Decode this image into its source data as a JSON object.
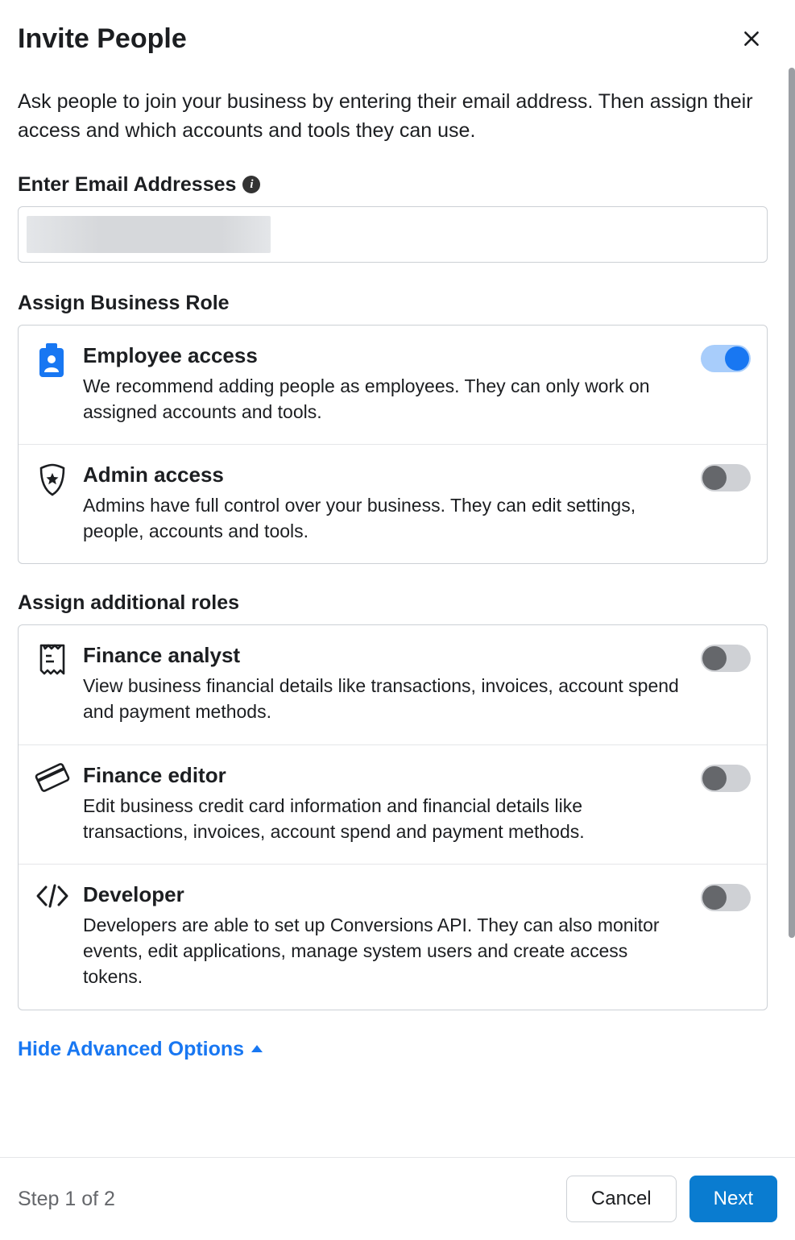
{
  "title": "Invite People",
  "description": "Ask people to join your business by entering their email address. Then assign their access and which accounts and tools they can use.",
  "email_section_label": "Enter Email Addresses",
  "business_role_label": "Assign Business Role",
  "business_roles": [
    {
      "title": "Employee access",
      "description": "We recommend adding people as employees. They can only work on assigned accounts and tools.",
      "enabled": true,
      "icon": "badge-person-icon"
    },
    {
      "title": "Admin access",
      "description": "Admins have full control over your business. They can edit settings, people, accounts and tools.",
      "enabled": false,
      "icon": "shield-star-icon"
    }
  ],
  "additional_roles_label": "Assign additional roles",
  "additional_roles": [
    {
      "title": "Finance analyst",
      "description": "View business financial details like transactions, invoices, account spend and payment methods.",
      "enabled": false,
      "icon": "receipt-icon"
    },
    {
      "title": "Finance editor",
      "description": "Edit business credit card information and financial details like transactions, invoices, account spend and payment methods.",
      "enabled": false,
      "icon": "credit-card-icon"
    },
    {
      "title": "Developer",
      "description": "Developers are able to set up Conversions API. They can also monitor events, edit applications, manage system users and create access tokens.",
      "enabled": false,
      "icon": "code-icon"
    }
  ],
  "advanced_options_label": "Hide Advanced Options",
  "footer": {
    "step_text": "Step 1 of 2",
    "cancel_label": "Cancel",
    "next_label": "Next"
  }
}
